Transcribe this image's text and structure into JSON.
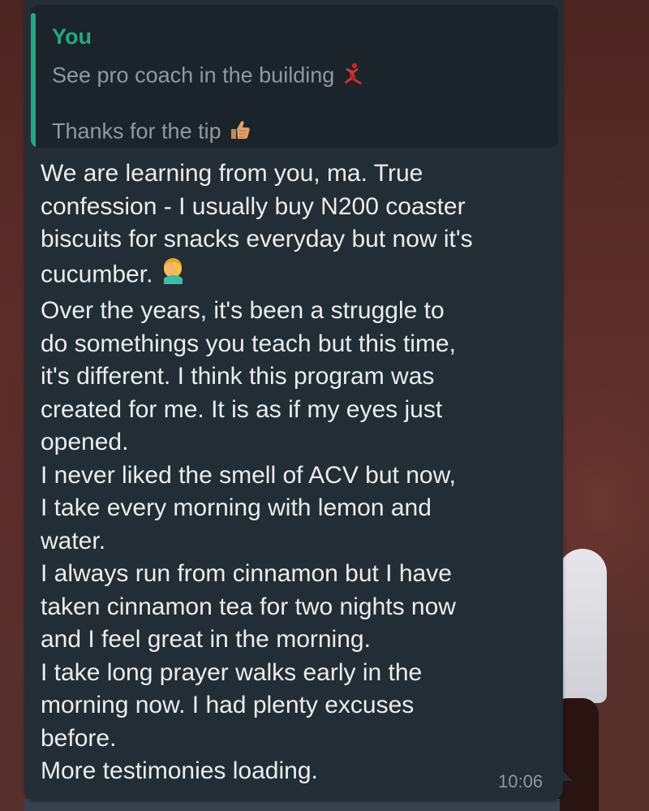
{
  "quoted_message": {
    "sender": "You",
    "line1": "See pro coach in the building",
    "line1_emoji": "woman-dancing-icon",
    "line2": "Thanks for the tip",
    "line2_emoji": "thumbs-up-icon"
  },
  "message": {
    "lines": [
      "We are learning from you, ma. True",
      "confession - I usually buy N200 coaster",
      "biscuits for snacks everyday but now it's",
      "cucumber.",
      "Over the years, it's been a struggle to",
      "do somethings you teach but this time,",
      "it's different. I think this program was",
      "created for me. It is as if my eyes just",
      "opened.",
      "I never liked the smell of ACV but now,",
      "I take every morning with lemon and",
      "water.",
      "I always run from cinnamon but I have",
      "taken cinnamon tea for two nights now",
      "and I feel great in the morning.",
      "I take long prayer walks early in the",
      "morning now. I had plenty excuses",
      "before.",
      "More testimonies loading."
    ],
    "line4_emoji": "face-palm-icon",
    "time": "10:06"
  },
  "colors": {
    "bubble": "#232d35",
    "quote_background": "#1b242b",
    "quote_accent": "#25a884",
    "text": "#e9edef",
    "muted_text": "#8f999f",
    "wallpaper": "#5a2c28"
  }
}
